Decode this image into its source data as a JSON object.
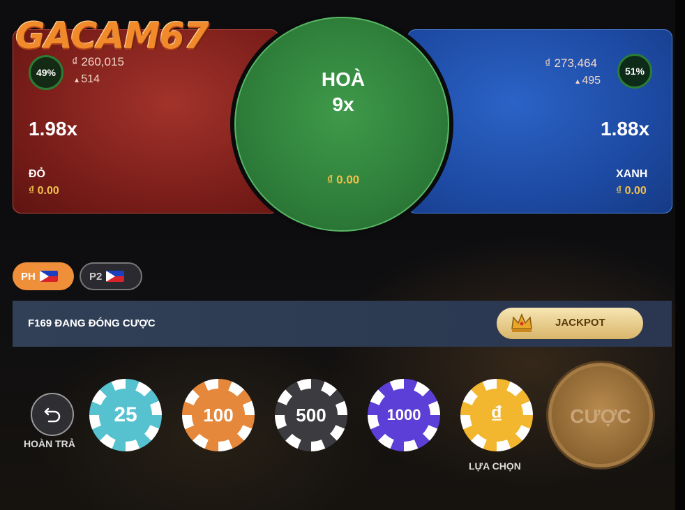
{
  "logo": "GACAM67",
  "red": {
    "percent": "49%",
    "amount": "₫ 260,015",
    "players": "514",
    "odds": "1.98x",
    "name": "ĐỎ",
    "bet": "₫ 0.00"
  },
  "draw": {
    "title": "HOÀ",
    "odds": "9x",
    "bet": "₫ 0.00"
  },
  "blue": {
    "percent": "51%",
    "amount": "₫ 273,464",
    "players": "495",
    "odds": "1.88x",
    "name": "XANH",
    "bet": "₫ 0.00"
  },
  "tables": [
    {
      "label": "PH"
    },
    {
      "label": "P2"
    }
  ],
  "status": {
    "text": "F169 ĐANG ĐÓNG CƯỢC",
    "jackpot": "JACKPOT"
  },
  "controls": {
    "undo_label": "HOÀN TRẢ",
    "chips": [
      {
        "value": "25",
        "color": "#56c2cf"
      },
      {
        "value": "100",
        "color": "#e5883b"
      },
      {
        "value": "500",
        "color": "#3c3c40"
      },
      {
        "value": "1000",
        "color": "#5b3fd7"
      },
      {
        "value": "₫",
        "color": "#f2b62f"
      }
    ],
    "custom_label": "LỰA CHỌN",
    "bet_button": "CƯỢC"
  }
}
